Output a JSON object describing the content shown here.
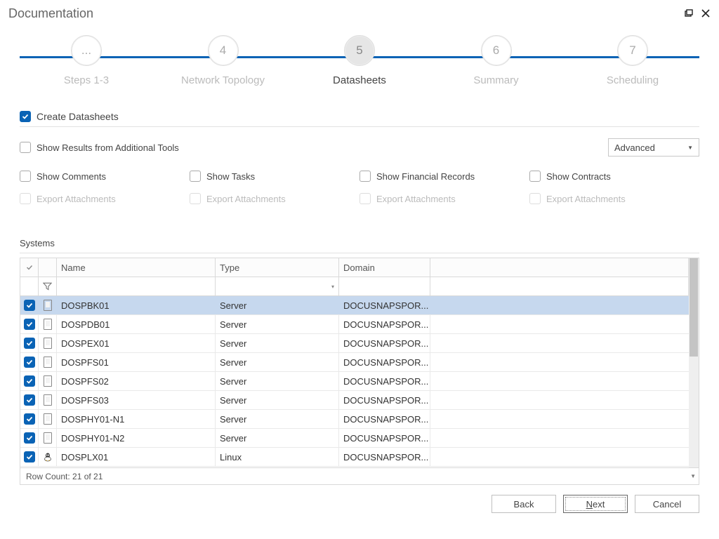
{
  "window": {
    "title": "Documentation"
  },
  "stepper": {
    "steps": [
      {
        "num": "...",
        "label": "Steps 1-3"
      },
      {
        "num": "4",
        "label": "Network Topology"
      },
      {
        "num": "5",
        "label": "Datasheets"
      },
      {
        "num": "6",
        "label": "Summary"
      },
      {
        "num": "7",
        "label": "Scheduling"
      }
    ],
    "active_index": 2
  },
  "main_toggle": {
    "label": "Create Datasheets",
    "checked": true
  },
  "additional_tools": {
    "label": "Show Results from Additional Tools",
    "checked": false
  },
  "mode_dropdown": {
    "value": "Advanced"
  },
  "option_columns": [
    {
      "show": "Show Comments",
      "export": "Export Attachments"
    },
    {
      "show": "Show Tasks",
      "export": "Export Attachments"
    },
    {
      "show": "Show Financial Records",
      "export": "Export Attachments"
    },
    {
      "show": "Show Contracts",
      "export": "Export Attachments"
    }
  ],
  "systems": {
    "label": "Systems",
    "columns": {
      "name": "Name",
      "type": "Type",
      "domain": "Domain"
    },
    "rows": [
      {
        "name": "DOSPBK01",
        "type": "Server",
        "domain": "DOCUSNAPSPOR...",
        "os": "win"
      },
      {
        "name": "DOSPDB01",
        "type": "Server",
        "domain": "DOCUSNAPSPOR...",
        "os": "win"
      },
      {
        "name": "DOSPEX01",
        "type": "Server",
        "domain": "DOCUSNAPSPOR...",
        "os": "win"
      },
      {
        "name": "DOSPFS01",
        "type": "Server",
        "domain": "DOCUSNAPSPOR...",
        "os": "win"
      },
      {
        "name": "DOSPFS02",
        "type": "Server",
        "domain": "DOCUSNAPSPOR...",
        "os": "win"
      },
      {
        "name": "DOSPFS03",
        "type": "Server",
        "domain": "DOCUSNAPSPOR...",
        "os": "win"
      },
      {
        "name": "DOSPHY01-N1",
        "type": "Server",
        "domain": "DOCUSNAPSPOR...",
        "os": "win"
      },
      {
        "name": "DOSPHY01-N2",
        "type": "Server",
        "domain": "DOCUSNAPSPOR...",
        "os": "win"
      },
      {
        "name": "DOSPLX01",
        "type": "Linux",
        "domain": "DOCUSNAPSPOR...",
        "os": "linux"
      }
    ],
    "selected_index": 0,
    "footer": "Row Count: 21 of 21"
  },
  "buttons": {
    "back": "Back",
    "next": "Next",
    "cancel": "Cancel"
  }
}
